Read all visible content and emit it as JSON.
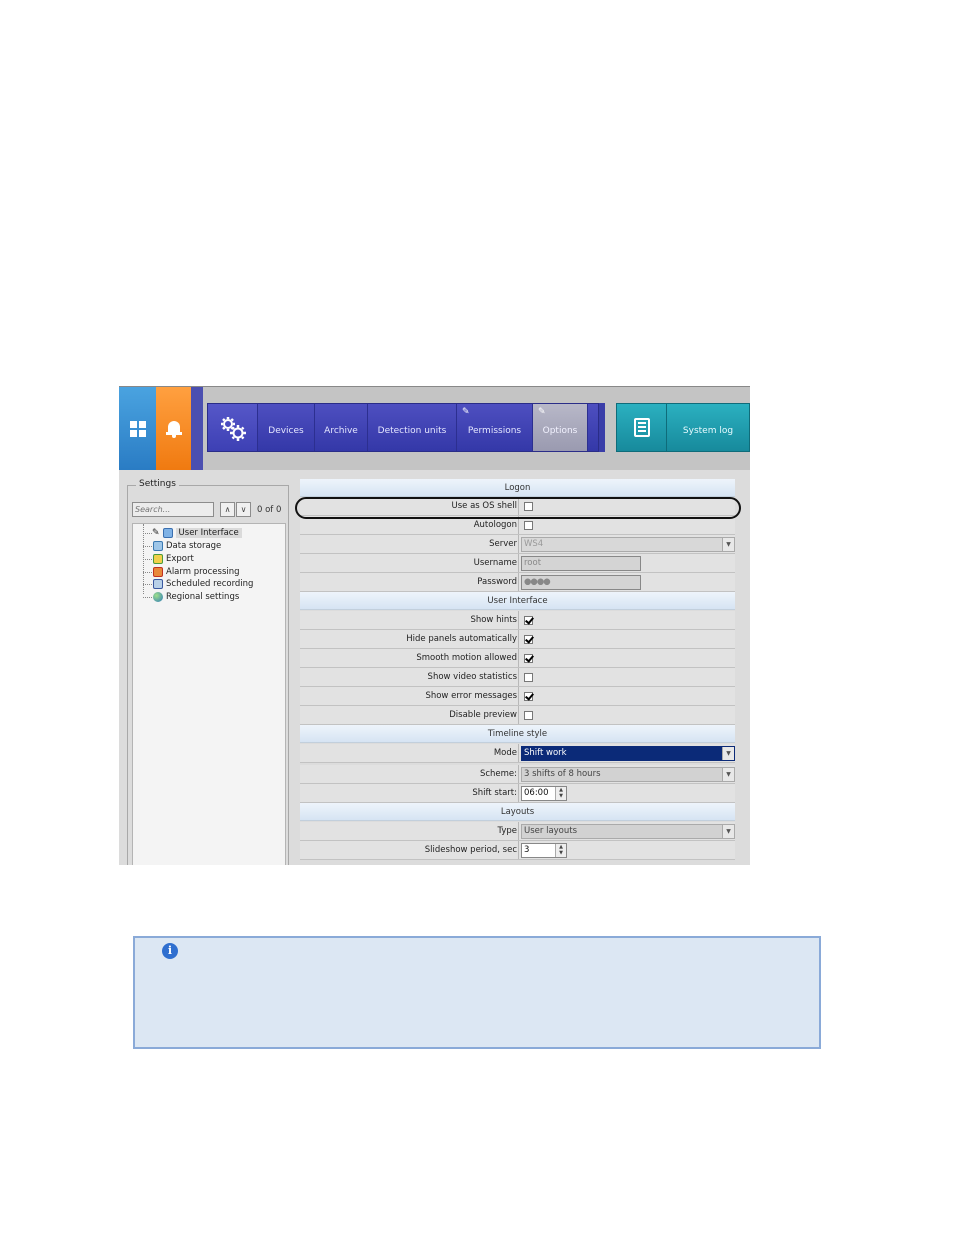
{
  "toolbar": {
    "tabs": [
      {
        "label": "Devices"
      },
      {
        "label": "Archive"
      },
      {
        "label": "Detection units"
      },
      {
        "label": "Permissions"
      },
      {
        "label": "Options"
      }
    ],
    "active_tab": "Options",
    "system_log_label": "System log",
    "colors": {
      "windows_tile": "#2a7cc4",
      "alerts_tile": "#f07a10",
      "menu_strip": "#3d40b4",
      "system_log_strip": "#178a9c"
    }
  },
  "settings": {
    "legend": "Settings",
    "search_placeholder": "Search...",
    "match_count": "0 of 0",
    "tree": [
      {
        "label": "User Interface",
        "icon": "user-interface-icon",
        "selected": true
      },
      {
        "label": "Data storage",
        "icon": "data-storage-icon"
      },
      {
        "label": "Export",
        "icon": "export-icon"
      },
      {
        "label": "Alarm processing",
        "icon": "alarm-processing-icon"
      },
      {
        "label": "Scheduled recording",
        "icon": "scheduled-recording-icon"
      },
      {
        "label": "Regional settings",
        "icon": "globe-icon"
      }
    ]
  },
  "properties": {
    "logon": {
      "title": "Logon",
      "use_os_shell": {
        "label": "Use as OS shell",
        "checked": false
      },
      "autologon": {
        "label": "Autologon",
        "checked": false
      },
      "server": {
        "label": "Server",
        "value": "WS4"
      },
      "username": {
        "label": "Username",
        "value": "root"
      },
      "password": {
        "label": "Password",
        "value": "●●●●"
      }
    },
    "user_interface": {
      "title": "User Interface",
      "show_hints": {
        "label": "Show hints",
        "checked": true
      },
      "hide_panels": {
        "label": "Hide panels automatically",
        "checked": true
      },
      "smooth_motion": {
        "label": "Smooth motion allowed",
        "checked": true
      },
      "show_video_stats": {
        "label": "Show video statistics",
        "checked": false
      },
      "show_errors": {
        "label": "Show error messages",
        "checked": true
      },
      "disable_preview": {
        "label": "Disable preview",
        "checked": false
      }
    },
    "timeline": {
      "title": "Timeline style",
      "mode": {
        "label": "Mode",
        "value": "Shift work"
      },
      "scheme": {
        "label": "Scheme:",
        "value": "3 shifts of 8 hours"
      },
      "shift_start": {
        "label": "Shift start:",
        "value": "06:00"
      }
    },
    "layouts": {
      "title": "Layouts",
      "type": {
        "label": "Type",
        "value": "User layouts"
      },
      "slideshow": {
        "label": "Slideshow period, sec",
        "value": "3"
      }
    }
  },
  "note": {
    "icon": "info-icon"
  }
}
